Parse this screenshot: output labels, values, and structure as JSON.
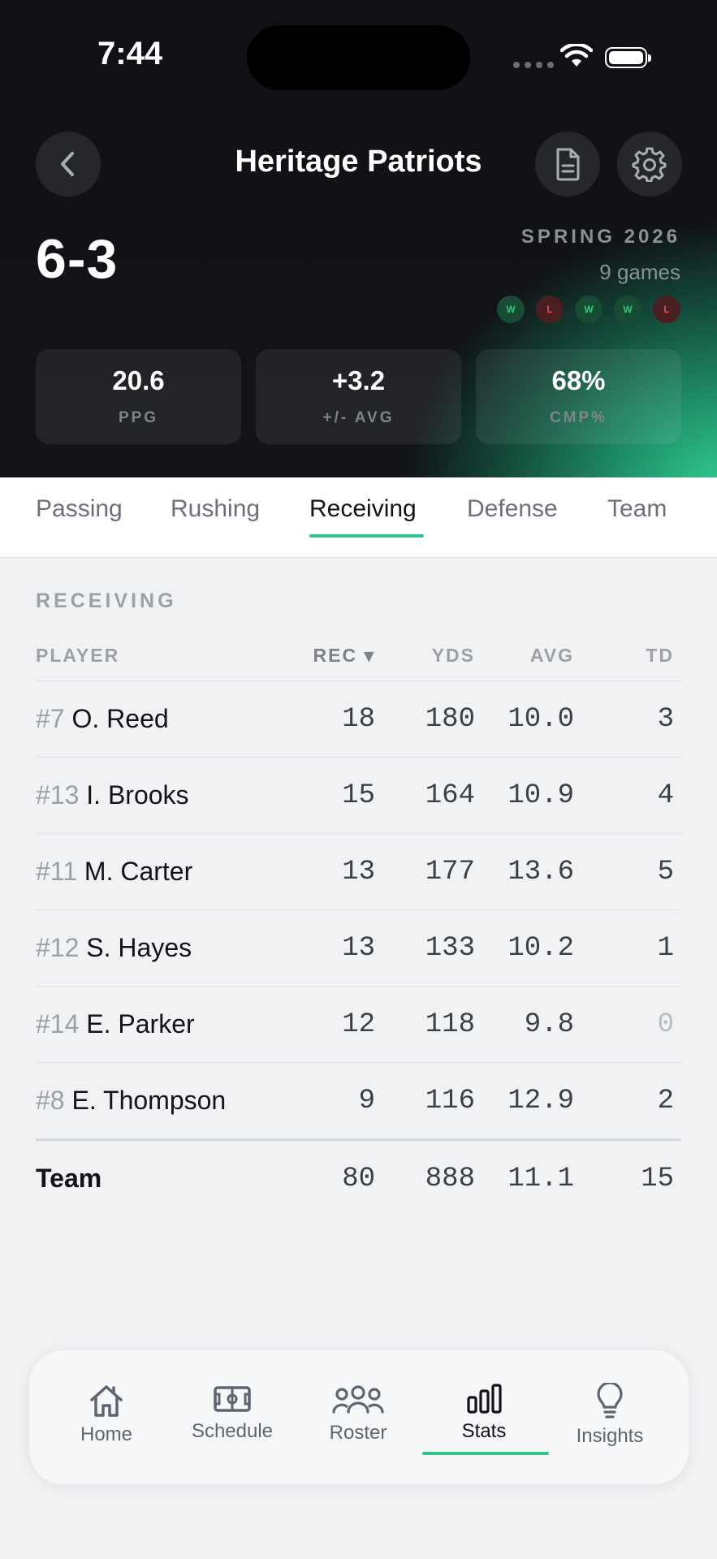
{
  "status_bar": {
    "time": "7:44"
  },
  "header": {
    "title": "Heritage Patriots",
    "record": "6-3",
    "season": "SPRING 2026",
    "games": "9 games",
    "form": [
      {
        "result": "W"
      },
      {
        "result": "L"
      },
      {
        "result": "W"
      },
      {
        "result": "W"
      },
      {
        "result": "L"
      }
    ],
    "summary": [
      {
        "value": "20.6",
        "label": "PPG"
      },
      {
        "value": "+3.2",
        "label": "+/- AVG"
      },
      {
        "value": "68%",
        "label": "CMP%"
      }
    ]
  },
  "tabs": [
    "Passing",
    "Rushing",
    "Receiving",
    "Defense",
    "Team"
  ],
  "active_tab": "Receiving",
  "section": {
    "title": "RECEIVING",
    "columns": {
      "player": "PLAYER",
      "rec": "REC ▾",
      "yds": "YDS",
      "avg": "AVG",
      "td": "TD"
    },
    "rows": [
      {
        "jersey": "#7",
        "name": "O. Reed",
        "rec": "18",
        "yds": "180",
        "avg": "10.0",
        "td": "3"
      },
      {
        "jersey": "#13",
        "name": "I. Brooks",
        "rec": "15",
        "yds": "164",
        "avg": "10.9",
        "td": "4"
      },
      {
        "jersey": "#11",
        "name": "M. Carter",
        "rec": "13",
        "yds": "177",
        "avg": "13.6",
        "td": "5"
      },
      {
        "jersey": "#12",
        "name": "S. Hayes",
        "rec": "13",
        "yds": "133",
        "avg": "10.2",
        "td": "1"
      },
      {
        "jersey": "#14",
        "name": "E. Parker",
        "rec": "12",
        "yds": "118",
        "avg": "9.8",
        "td": "0"
      },
      {
        "jersey": "#8",
        "name": "E. Thompson",
        "rec": "9",
        "yds": "116",
        "avg": "12.9",
        "td": "2"
      }
    ],
    "total": {
      "name": "Team",
      "rec": "80",
      "yds": "888",
      "avg": "11.1",
      "td": "15"
    }
  },
  "bottom_nav": [
    {
      "label": "Home",
      "icon": "home-icon"
    },
    {
      "label": "Schedule",
      "icon": "field-icon"
    },
    {
      "label": "Roster",
      "icon": "people-icon"
    },
    {
      "label": "Stats",
      "icon": "bar-chart-icon"
    },
    {
      "label": "Insights",
      "icon": "lightbulb-icon"
    }
  ],
  "colors": {
    "accent": "#2fc48c",
    "win": "#35c879",
    "loss": "#e24b4b"
  }
}
